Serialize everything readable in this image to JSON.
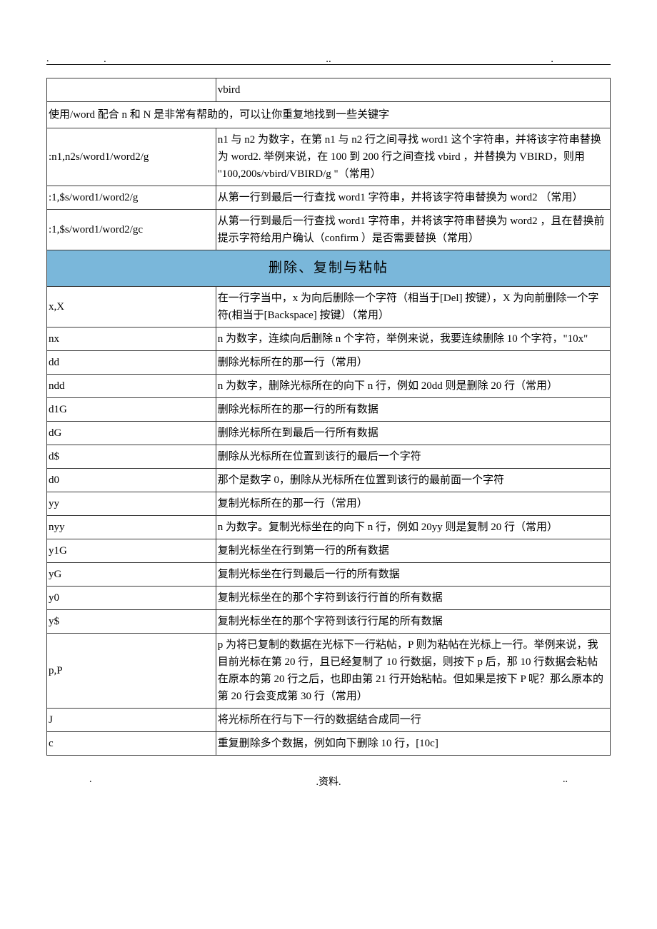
{
  "top_dots": {
    "left": ".",
    "mid": "..",
    "right": "."
  },
  "rows": [
    {
      "type": "row",
      "key": "",
      "desc": "vbird"
    },
    {
      "type": "span",
      "text": "使用/word   配合 n 和 N 是非常有帮助的，可以让你重复地找到一些关键字"
    },
    {
      "type": "row",
      "key": ":n1,n2s/word1/word2/g",
      "desc": "n1 与 n2 为数字，在第 n1 与 n2 行之间寻找 word1   这个字符串，并将该字符串替换为 word2.  举例来说，在 100 到 200  行之间查找 vbird ，并替换为 VBIRD，则用 \"100,200s/vbird/VBIRD/g   \"（常用）"
    },
    {
      "type": "row",
      "key": ":1,$s/word1/word2/g",
      "desc": "从第一行到最后一行查找 word1   字符串，并将该字符串替换为 word2  （常用）"
    },
    {
      "type": "row",
      "key": ":1,$s/word1/word2/gc",
      "desc": "从第一行到最后一行查找 word1   字符串，并将该字符串替换为 word2  ，且在替换前提示字符给用户确认（confirm  ）是否需要替换（常用）"
    },
    {
      "type": "header",
      "text": "删除、复制与粘帖"
    },
    {
      "type": "row",
      "key": "x,X",
      "desc": "在一行字当中，x 为向后删除一个字符（相当于[Del] 按键），X 为向前删除一个字符(相当于[Backspace] 按键）（常用）"
    },
    {
      "type": "row",
      "key": "nx",
      "desc": "n 为数字，连续向后删除 n 个字符，举例来说，我要连续删除 10 个字符，\"10x\""
    },
    {
      "type": "row",
      "key": "dd",
      "desc": "删除光标所在的那一行（常用）"
    },
    {
      "type": "row",
      "key": "ndd",
      "desc": "n 为数字，删除光标所在的向下 n 行，例如 20dd  则是删除 20 行（常用）"
    },
    {
      "type": "row",
      "key": "d1G",
      "desc": "删除光标所在的那一行的所有数据"
    },
    {
      "type": "row",
      "key": "dG",
      "desc": "删除光标所在到最后一行所有数据"
    },
    {
      "type": "row",
      "key": "d$",
      "desc": "删除从光标所在位置到该行的最后一个字符"
    },
    {
      "type": "row",
      "key": "d0",
      "desc": "那个是数字 0，删除从光标所在位置到该行的最前面一个字符"
    },
    {
      "type": "row",
      "key": "yy",
      "desc": "复制光标所在的那一行（常用）"
    },
    {
      "type": "row",
      "key": "nyy",
      "desc": "n 为数字。复制光标坐在的向下 n 行，例如 20yy  则是复制 20  行（常用）"
    },
    {
      "type": "row",
      "key": "y1G",
      "desc": "复制光标坐在行到第一行的所有数据"
    },
    {
      "type": "row",
      "key": "yG",
      "desc": "复制光标坐在行到最后一行的所有数据"
    },
    {
      "type": "row",
      "key": "y0",
      "desc": "复制光标坐在的那个字符到该行行首的所有数据"
    },
    {
      "type": "row",
      "key": "y$",
      "desc": "复制光标坐在的那个字符到该行行尾的所有数据"
    },
    {
      "type": "row",
      "key": "p,P",
      "desc": "p 为将已复制的数据在光标下一行粘帖，P 则为粘帖在光标上一行。举例来说，我目前光标在第 20 行，且已经复制了 10 行数据，则按下 p 后，那 10 行数据会粘帖在原本的第 20 行之后，也即由第 21 行开始粘帖。但如果是按下 P 呢？那么原本的第 20 行会变成第 30 行（常用）"
    },
    {
      "type": "row",
      "key": "J",
      "desc": "将光标所在行与下一行的数据结合成同一行"
    },
    {
      "type": "row",
      "key": "c",
      "desc": "重复删除多个数据，例如向下删除 10 行，[10c]"
    }
  ],
  "footer": {
    "left": ".",
    "mid": ".资料.",
    "right": ".."
  }
}
